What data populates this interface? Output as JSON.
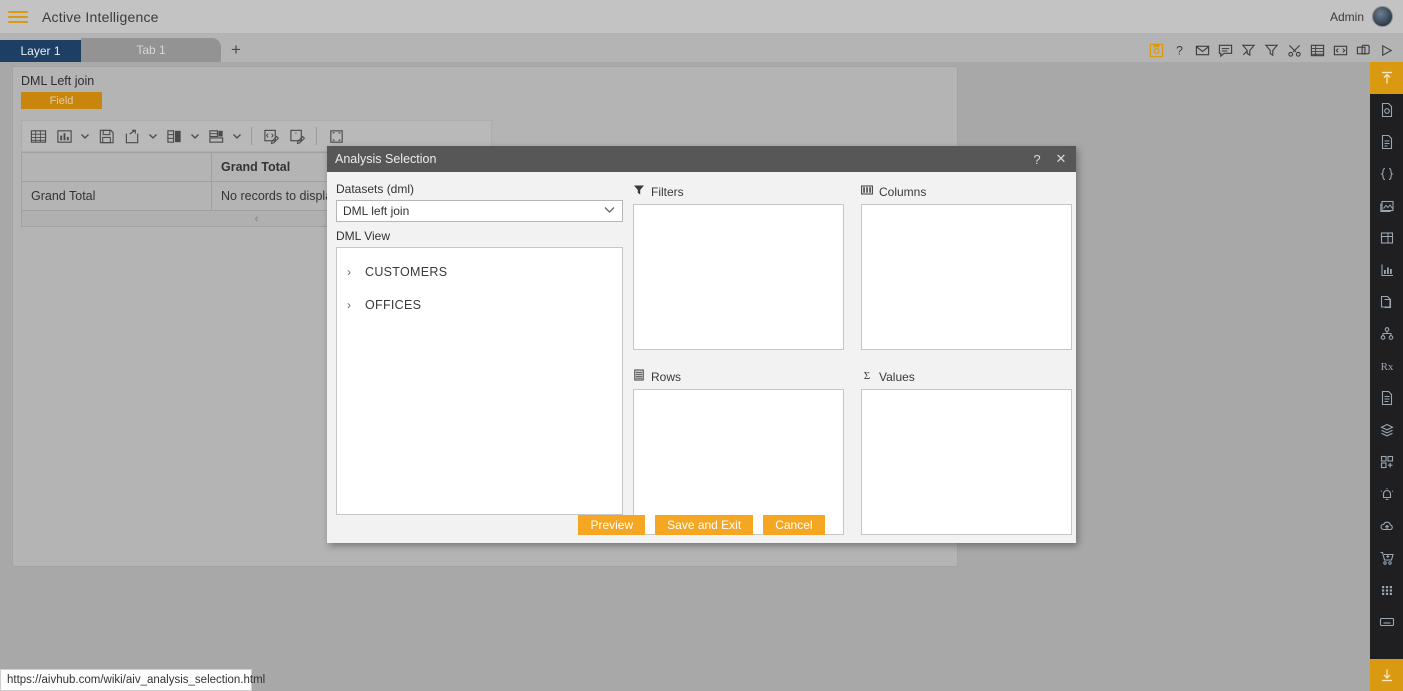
{
  "header": {
    "menu_icon": "hamburger-icon",
    "app_title": "Active Intelligence",
    "user_label": "Admin",
    "avatar_icon": "avatar-icon"
  },
  "tabstrip": {
    "layer_tab": "Layer 1",
    "sheet_tab": "Tab 1",
    "add_tab": "+",
    "icons": [
      {
        "name": "save-icon",
        "title": "Save"
      },
      {
        "name": "help-icon",
        "title": "Help"
      },
      {
        "name": "mail-icon",
        "title": "Mail"
      },
      {
        "name": "comment-icon",
        "title": "Comment"
      },
      {
        "name": "clear-filter-icon",
        "title": "Clear filter"
      },
      {
        "name": "filter-icon",
        "title": "Filter"
      },
      {
        "name": "tools-icon",
        "title": "Tools"
      },
      {
        "name": "table-icon",
        "title": "Table"
      },
      {
        "name": "code-icon",
        "title": "Code"
      },
      {
        "name": "copy-icon",
        "title": "Copy"
      },
      {
        "name": "run-icon",
        "title": "Run"
      }
    ]
  },
  "panel": {
    "title": "DML Left join",
    "field_chip": "Field",
    "toolbar": [
      {
        "name": "grid-view-icon",
        "caret": false
      },
      {
        "name": "chart-view-icon",
        "caret": true
      },
      {
        "name": "save-icon",
        "caret": false
      },
      {
        "name": "export-icon",
        "caret": true
      },
      {
        "name": "layout-split-icon",
        "caret": true
      },
      {
        "name": "layout-stack-icon",
        "caret": true
      },
      {
        "name": "separator",
        "caret": false
      },
      {
        "name": "edit-code-icon",
        "caret": false
      },
      {
        "name": "edit-text-icon",
        "caret": false
      },
      {
        "name": "separator",
        "caret": false
      },
      {
        "name": "expand-icon",
        "caret": false
      }
    ],
    "grid": {
      "col_header": "Grand Total",
      "row_header": "Grand Total",
      "cell_value": "No records to display",
      "scroll_glyph": "‹"
    }
  },
  "modal": {
    "title": "Analysis Selection",
    "help_icon": "?",
    "close_icon": "✕",
    "datasets_label": "Datasets (dml)",
    "dataset_selected": "DML left join",
    "view_label": "DML View",
    "tree": [
      {
        "label": "CUSTOMERS",
        "arrow": "›"
      },
      {
        "label": "OFFICES",
        "arrow": "›"
      }
    ],
    "zones": [
      {
        "key": "filters",
        "title": "Filters",
        "icon": "filter-icon",
        "items": []
      },
      {
        "key": "columns",
        "title": "Columns",
        "icon": "columns-icon",
        "items": []
      },
      {
        "key": "rows",
        "title": "Rows",
        "icon": "rows-icon",
        "items": []
      },
      {
        "key": "values",
        "title": "Values",
        "icon": "sigma-icon",
        "items": []
      }
    ],
    "buttons": {
      "preview": "Preview",
      "save_and_exit": "Save and Exit",
      "cancel": "Cancel"
    }
  },
  "rail": {
    "top_icons": [
      {
        "name": "pin-top-icon",
        "accent": true
      },
      {
        "name": "document-refresh-icon",
        "accent": false
      },
      {
        "name": "document-icon",
        "accent": false
      },
      {
        "name": "braces-icon",
        "accent": false
      },
      {
        "name": "image-icon",
        "accent": false
      },
      {
        "name": "table-layout-icon",
        "accent": false
      },
      {
        "name": "chart-icon",
        "accent": false
      },
      {
        "name": "copy-page-icon",
        "accent": false
      },
      {
        "name": "hierarchy-icon",
        "accent": false
      },
      {
        "name": "prescription-icon",
        "accent": false
      },
      {
        "name": "document-plain-icon",
        "accent": false
      },
      {
        "name": "layers-icon",
        "accent": false
      },
      {
        "name": "add-widget-icon",
        "accent": false
      },
      {
        "name": "bell-icon",
        "accent": false
      },
      {
        "name": "cloud-upload-icon",
        "accent": false
      },
      {
        "name": "cart-add-icon",
        "accent": false
      },
      {
        "name": "grid-dots-icon",
        "accent": false
      },
      {
        "name": "window-icon",
        "accent": false
      }
    ],
    "bottom_icon": {
      "name": "download-icon",
      "accent": true
    }
  },
  "statusbar": {
    "url": "https://aivhub.com/wiki/aiv_analysis_selection.html"
  },
  "colors": {
    "accent_orange": "#f5a623",
    "chip_orange": "#c8860d",
    "rail_dark": "#1f1f22",
    "layer_tab_blue": "#1d3f63",
    "titlebar_gray": "#575757"
  }
}
